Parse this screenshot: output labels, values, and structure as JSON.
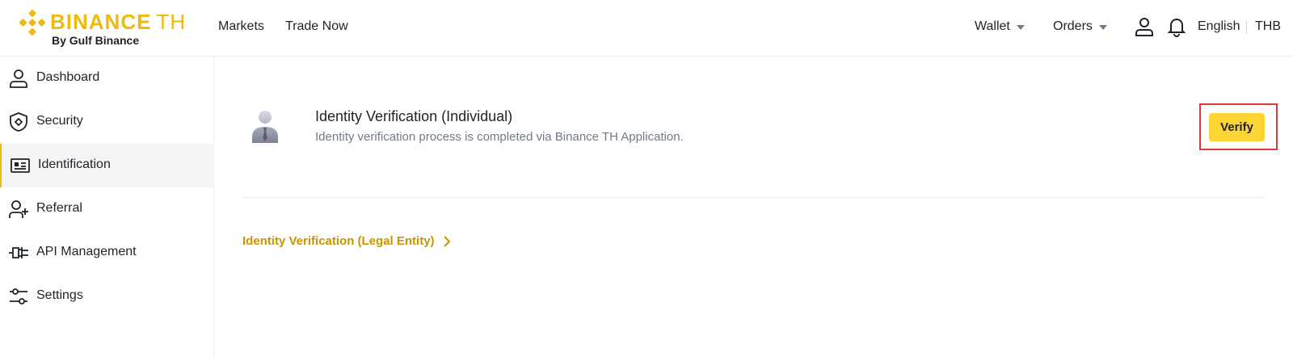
{
  "header": {
    "logo_main": "BINANCE",
    "logo_suffix": "TH",
    "logo_sub": "By Gulf Binance",
    "nav": [
      {
        "label": "Markets"
      },
      {
        "label": "Trade Now"
      }
    ],
    "wallet_label": "Wallet",
    "orders_label": "Orders",
    "language": "English",
    "currency": "THB"
  },
  "sidebar": {
    "items": [
      {
        "label": "Dashboard",
        "icon": "user-icon"
      },
      {
        "label": "Security",
        "icon": "shield-icon"
      },
      {
        "label": "Identification",
        "icon": "id-card-icon",
        "active": true
      },
      {
        "label": "Referral",
        "icon": "add-user-icon"
      },
      {
        "label": "API Management",
        "icon": "plug-icon"
      },
      {
        "label": "Settings",
        "icon": "sliders-icon"
      }
    ]
  },
  "main": {
    "individual": {
      "title": "Identity Verification (Individual)",
      "description": "Identity verification process is completed via Binance TH Application.",
      "button_label": "Verify"
    },
    "legal_entity_link": "Identity Verification (Legal Entity)"
  },
  "colors": {
    "brand": "#f0b90b",
    "button": "#fcd535",
    "link": "#c99400",
    "highlight_border": "#e53935"
  }
}
